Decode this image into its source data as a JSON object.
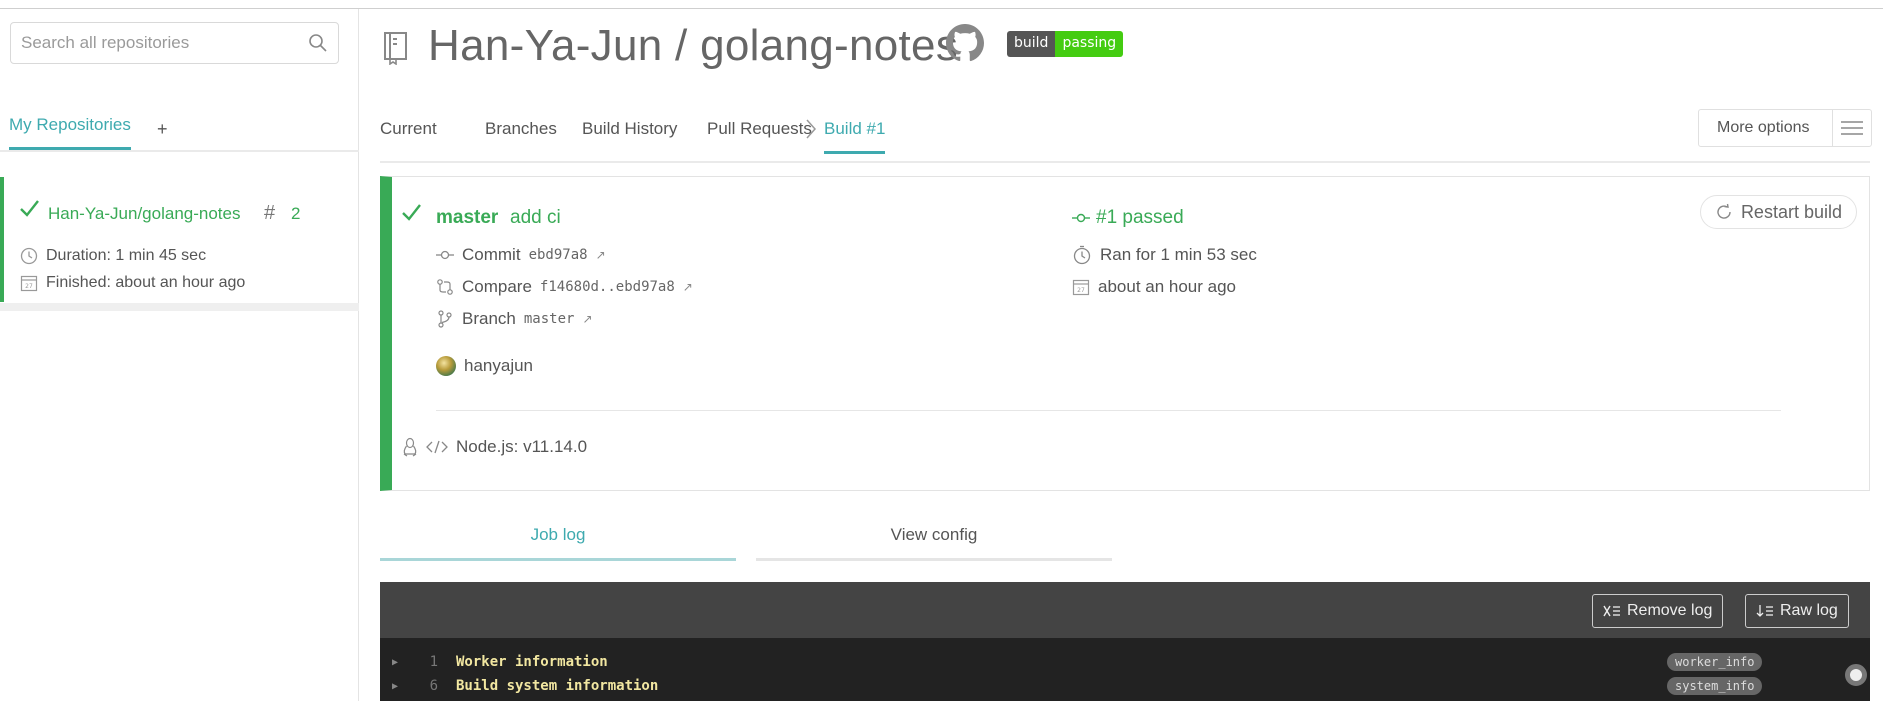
{
  "sidebar": {
    "search_placeholder": "Search all repositories",
    "tab_active": "My Repositories",
    "tab_add": "+",
    "repo": {
      "name": "Han-Ya-Jun/golang-notes",
      "hash_symbol": "#",
      "build_number": "2",
      "duration": "Duration: 1 min 45 sec",
      "finished": "Finished: about an hour ago",
      "status_color": "#39aa56"
    }
  },
  "header": {
    "owner": "Han-Ya-Jun",
    "separator": "/",
    "repo": "golang-notes",
    "badge_left": "build",
    "badge_right": "passing"
  },
  "nav": {
    "items": [
      "Current",
      "Branches",
      "Build History",
      "Pull Requests"
    ],
    "active": "Build #1",
    "more_options": "More options"
  },
  "build": {
    "branch": "master",
    "message": "add ci",
    "commit_label": "Commit",
    "commit_hash": "ebd97a8",
    "compare_label": "Compare",
    "compare_range": "f14680d..ebd97a8",
    "branch_label": "Branch",
    "branch_name": "master",
    "author": "hanyajun",
    "status": "#1 passed",
    "ran_for": "Ran for 1 min 53 sec",
    "when": "about an hour ago",
    "restart": "Restart build",
    "env": "Node.js: v11.14.0",
    "status_color": "#39aa56"
  },
  "tabs": {
    "job_log": "Job log",
    "view_config": "View config"
  },
  "log": {
    "remove": "Remove log",
    "raw": "Raw log",
    "lines": [
      {
        "num": "1",
        "text": "Worker information",
        "tag": "worker_info"
      },
      {
        "num": "6",
        "text": "Build system information",
        "tag": "system_info"
      }
    ]
  },
  "colors": {
    "accent": "#3eaaaf",
    "passed": "#39aa56",
    "log_bg": "#222222"
  }
}
